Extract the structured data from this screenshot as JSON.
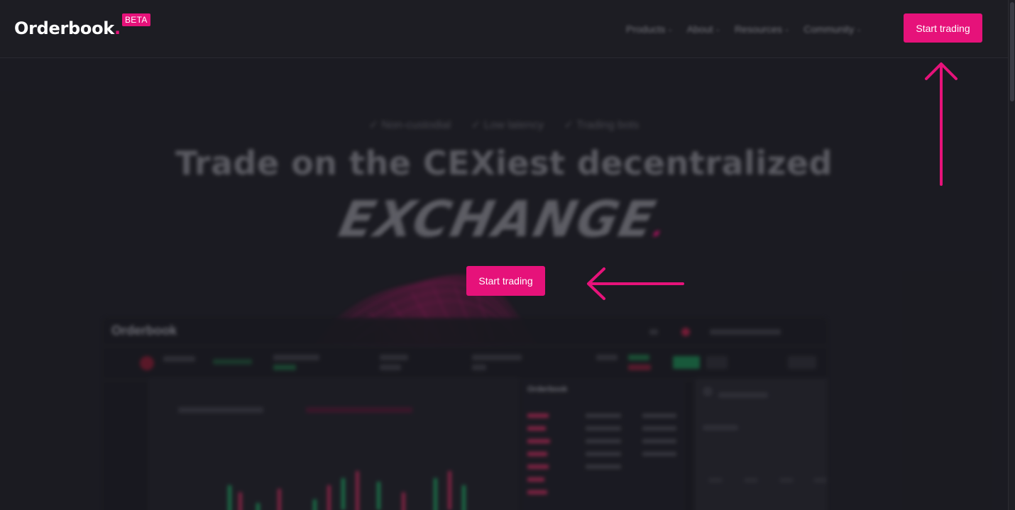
{
  "brand": {
    "name": "Orderbook",
    "dot": ".",
    "badge": "BETA",
    "accent_color": "#e6127a"
  },
  "nav": {
    "items": [
      {
        "label": "Products",
        "icon": "chevron-down-icon"
      },
      {
        "label": "About",
        "icon": "chevron-down-icon"
      },
      {
        "label": "Resources",
        "icon": "chevron-down-icon"
      },
      {
        "label": "Community",
        "icon": "chevron-down-icon"
      }
    ],
    "cta_label": "Start trading"
  },
  "hero": {
    "features": [
      "✓ Non-custodial",
      "✓ Low latency",
      "✓ Trading bots"
    ],
    "title": "Trade on the CEXiest decentralized",
    "highlight_word": "EXCHANGE",
    "highlight_dot": ".",
    "cta_label": "Start trading"
  },
  "preview": {
    "app_name": "Orderbook",
    "orderbook_label": "Orderbook"
  },
  "annotations": {
    "arrow_color": "#e6127a",
    "arrows": [
      "up-arrow-icon",
      "left-arrow-icon"
    ]
  }
}
